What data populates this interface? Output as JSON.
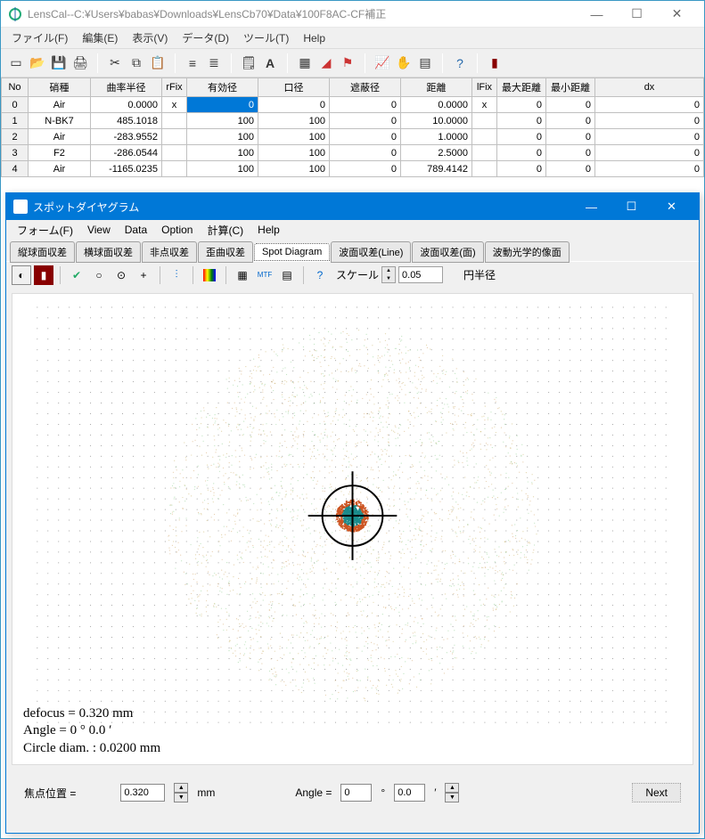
{
  "main": {
    "title": "LensCal--C:¥Users¥babas¥Downloads¥LensCb70¥Data¥100F8AC-CF補正",
    "menus": [
      "ファイル(F)",
      "編集(E)",
      "表示(V)",
      "データ(D)",
      "ツール(T)",
      "Help"
    ]
  },
  "table": {
    "headers": [
      "No",
      "硝種",
      "曲率半径",
      "rFix",
      "有効径",
      "口径",
      "遮蔽径",
      "距離",
      "lFix",
      "最大距離",
      "最小距離",
      "dx"
    ],
    "rows": [
      {
        "no": "0",
        "glass": "Air",
        "radius": "0.0000",
        "rfix": "x",
        "effdia": "0",
        "aperture": "0",
        "obst": "0",
        "dist": "0.0000",
        "lfix": "x",
        "maxd": "0",
        "mind": "0",
        "dx": "0"
      },
      {
        "no": "1",
        "glass": "N-BK7",
        "radius": "485.1018",
        "rfix": "",
        "effdia": "100",
        "aperture": "100",
        "obst": "0",
        "dist": "10.0000",
        "lfix": "",
        "maxd": "0",
        "mind": "0",
        "dx": "0"
      },
      {
        "no": "2",
        "glass": "Air",
        "radius": "-283.9552",
        "rfix": "",
        "effdia": "100",
        "aperture": "100",
        "obst": "0",
        "dist": "1.0000",
        "lfix": "",
        "maxd": "0",
        "mind": "0",
        "dx": "0"
      },
      {
        "no": "3",
        "glass": "F2",
        "radius": "-286.0544",
        "rfix": "",
        "effdia": "100",
        "aperture": "100",
        "obst": "0",
        "dist": "2.5000",
        "lfix": "",
        "maxd": "0",
        "mind": "0",
        "dx": "0"
      },
      {
        "no": "4",
        "glass": "Air",
        "radius": "-1165.0235",
        "rfix": "",
        "effdia": "100",
        "aperture": "100",
        "obst": "0",
        "dist": "789.4142",
        "lfix": "",
        "maxd": "0",
        "mind": "0",
        "dx": "0"
      }
    ]
  },
  "child": {
    "title": "スポットダイヤグラム",
    "menus": [
      "フォーム(F)",
      "View",
      "Data",
      "Option",
      "計算(C)",
      "Help"
    ],
    "tabs": [
      "縦球面収差",
      "横球面収差",
      "非点収差",
      "歪曲収差",
      "Spot Diagram",
      "波面収差(Line)",
      "波面収差(面)",
      "波動光学的像面"
    ],
    "active_tab": 4,
    "scale_label": "スケール",
    "scale_value": "0.05",
    "radius_label": "円半径"
  },
  "canvas_text": {
    "line1": "defocus = 0.320 mm",
    "line2": "Angle   = 0 ° 0.0 ′",
    "line3": "Circle diam. : 0.0200 mm"
  },
  "bottom": {
    "focus_label": "焦点位置 =",
    "focus_value": "0.320",
    "unit_mm": "mm",
    "angle_label": "Angle =",
    "angle_deg": "0",
    "deg_sym": "°",
    "angle_min": "0.0",
    "min_sym": "′",
    "next": "Next"
  },
  "chart_data": {
    "type": "scatter",
    "title": "Spot Diagram",
    "scale_mm": 0.05,
    "defocus_mm": 0.32,
    "angle_deg": 0,
    "angle_min": 0.0,
    "circle_diam_mm": 0.02,
    "description": "Ray-trace spot diagram: dense cluster of rays forming a filled disc roughly 0.02 mm diameter at center, surrounded by a larger diffuse halo of sparse rays. Black reference circle ~0.04 mm diameter with crosshair overlay. Background grid of faint dots. Central spot rendered in teal/orange colored rays; halo in faint yellow/green dots.",
    "reference_circle_diam_mm": 0.04
  }
}
